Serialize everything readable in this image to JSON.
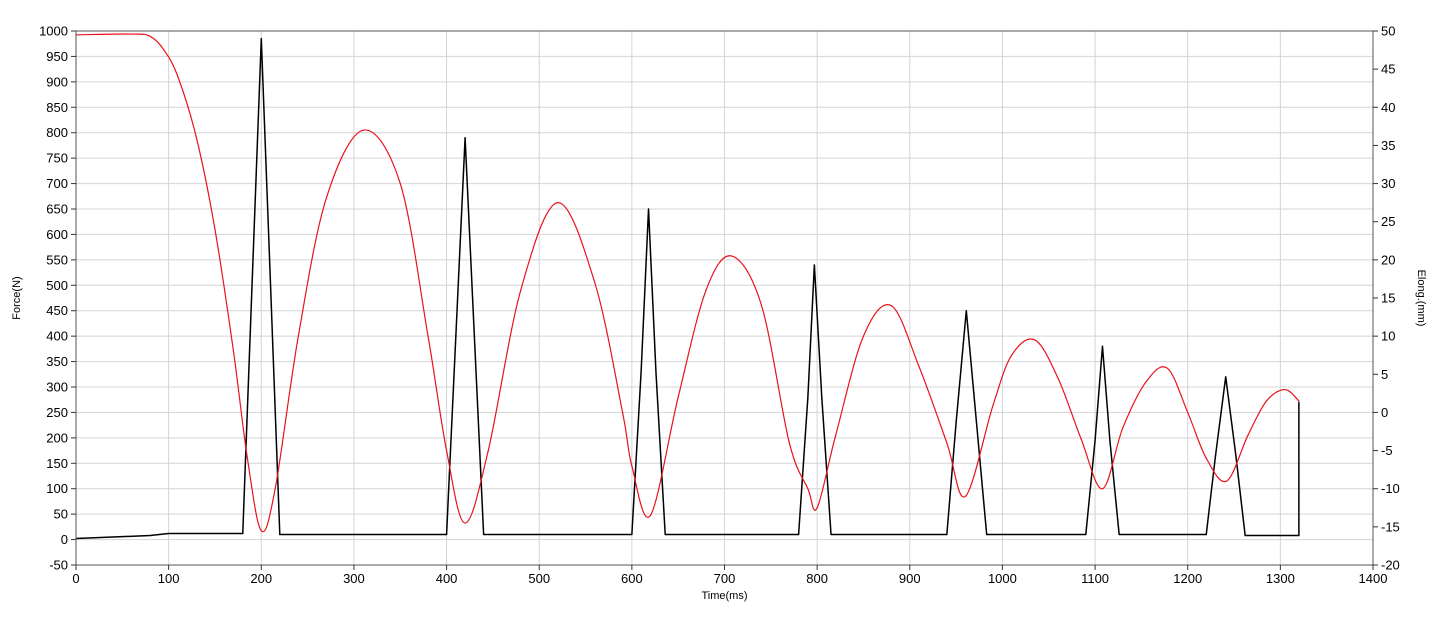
{
  "chart_data": {
    "type": "line",
    "title": "",
    "xlabel": "Time(ms)",
    "ylabel_left": "Force(N)",
    "ylabel_right": "Elong.(mm)",
    "xlim": [
      0,
      1400
    ],
    "ylim_left": [
      -50,
      1000
    ],
    "ylim_right": [
      -20,
      50
    ],
    "x_ticks": [
      0,
      100,
      200,
      300,
      400,
      500,
      600,
      700,
      800,
      900,
      1000,
      1100,
      1200,
      1300,
      1400
    ],
    "y_left_ticks": [
      -50,
      0,
      50,
      100,
      150,
      200,
      250,
      300,
      350,
      400,
      450,
      500,
      550,
      600,
      650,
      700,
      750,
      800,
      850,
      900,
      950,
      1000
    ],
    "y_right_ticks": [
      -20,
      -15,
      -10,
      -5,
      0,
      5,
      10,
      15,
      20,
      25,
      30,
      35,
      40,
      45,
      50
    ],
    "grid": true,
    "series": [
      {
        "axis": "left",
        "color": "#000000",
        "x": [
          0,
          80,
          100,
          180,
          190,
          200,
          210,
          220,
          400,
          410,
          420,
          430,
          440,
          600,
          610,
          618,
          626,
          636,
          780,
          790,
          797,
          805,
          815,
          940,
          950,
          961,
          972,
          983,
          1090,
          1100,
          1108,
          1116,
          1126,
          1220,
          1230,
          1241,
          1252,
          1262,
          1320,
          1320
        ],
        "y": [
          2,
          8,
          12,
          12,
          500,
          985,
          500,
          10,
          10,
          400,
          790,
          400,
          10,
          10,
          330,
          650,
          330,
          10,
          10,
          280,
          540,
          280,
          10,
          10,
          230,
          450,
          230,
          10,
          10,
          195,
          380,
          195,
          10,
          10,
          165,
          320,
          165,
          8,
          8,
          270
        ]
      },
      {
        "axis": "right",
        "color": "#e8131b",
        "x": [
          0,
          60,
          80,
          95,
          110,
          130,
          150,
          170,
          185,
          200,
          215,
          240,
          270,
          310,
          350,
          380,
          400,
          420,
          445,
          480,
          520,
          560,
          590,
          600,
          620,
          650,
          680,
          708,
          740,
          770,
          790,
          800,
          820,
          850,
          880,
          910,
          940,
          960,
          990,
          1010,
          1035,
          1060,
          1085,
          1108,
          1130,
          1155,
          1178,
          1200,
          1220,
          1242,
          1265,
          1285,
          1305,
          1320
        ],
        "y": [
          49.5,
          49.6,
          49.3,
          47.5,
          44.0,
          36.0,
          24.0,
          8.0,
          -6.0,
          -15.5,
          -10.0,
          10.0,
          28.0,
          37.0,
          30.0,
          10.0,
          -5.0,
          -14.5,
          -5.0,
          16.0,
          27.5,
          17.0,
          0.0,
          -7.0,
          -13.5,
          2.0,
          16.0,
          20.5,
          14.0,
          -4.0,
          -10.0,
          -12.5,
          -3.0,
          10.0,
          14.0,
          6.0,
          -4.0,
          -11.0,
          1.0,
          7.5,
          9.5,
          4.5,
          -3.5,
          -10.0,
          -2.0,
          4.0,
          5.8,
          0.0,
          -6.0,
          -9.0,
          -3.0,
          1.5,
          3.0,
          1.5
        ]
      }
    ]
  }
}
